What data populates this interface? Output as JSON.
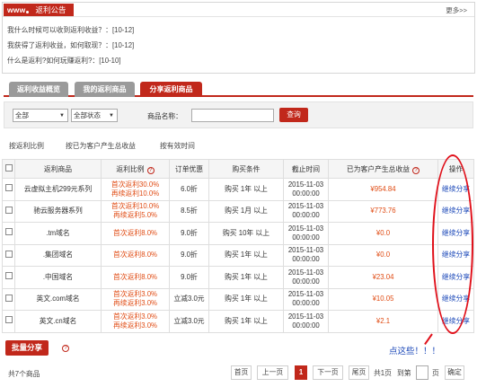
{
  "notice": {
    "logo_www": "www",
    "title": "返利公告",
    "more": "更多>>",
    "items": [
      "我什么时候可以收到返利收益？：[10-12]",
      "我获得了返利收益，如何取现？：[10-12]",
      "什么是返利?如何玩赚返利?：[10-10]"
    ]
  },
  "tabs": [
    "返利收益概览",
    "我的返利商品",
    "分享返利商品"
  ],
  "filter": {
    "select_all": "全部",
    "select_status": "全部状态",
    "name_label": "商品名称：",
    "search_button": "查询"
  },
  "sort": [
    "按返利比例",
    "按已为客户产生总收益",
    "按有效时间"
  ],
  "table": {
    "headers": [
      "返利商品",
      "返利比例",
      "订单优惠",
      "购买条件",
      "截止时间",
      "已为客户产生总收益",
      "操作"
    ],
    "rows": [
      {
        "product": "云虚拟主机299元系列",
        "rate1": "首次返利30.0%",
        "rate2": "再续返利10.0%",
        "discount": "6.0折",
        "condition": "购买 1年 以上",
        "deadline1": "2015-11-03",
        "deadline2": "00:00:00",
        "income": "¥954.84",
        "action": "继续分享"
      },
      {
        "product": "驰云服务器系列",
        "rate1": "首次返利10.0%",
        "rate2": "再续返利5.0%",
        "discount": "8.5折",
        "condition": "购买 1月 以上",
        "deadline1": "2015-11-03",
        "deadline2": "00:00:00",
        "income": "¥773.76",
        "action": "继续分享"
      },
      {
        "product": ".tm域名",
        "rate1": "首次返利8.0%",
        "rate2": "",
        "discount": "9.0折",
        "condition": "购买 10年 以上",
        "deadline1": "2015-11-03",
        "deadline2": "00:00:00",
        "income": "¥0.0",
        "action": "继续分享"
      },
      {
        "product": ".集团域名",
        "rate1": "首次返利8.0%",
        "rate2": "",
        "discount": "9.0折",
        "condition": "购买 1年 以上",
        "deadline1": "2015-11-03",
        "deadline2": "00:00:00",
        "income": "¥0.0",
        "action": "继续分享"
      },
      {
        "product": ".中国域名",
        "rate1": "首次返利8.0%",
        "rate2": "",
        "discount": "9.0折",
        "condition": "购买 1年 以上",
        "deadline1": "2015-11-03",
        "deadline2": "00:00:00",
        "income": "¥23.04",
        "action": "继续分享"
      },
      {
        "product": "英文.com域名",
        "rate1": "首次返利3.0%",
        "rate2": "再续返利3.0%",
        "discount": "立减3.0元",
        "condition": "购买 1年 以上",
        "deadline1": "2015-11-03",
        "deadline2": "00:00:00",
        "income": "¥10.05",
        "action": "继续分享"
      },
      {
        "product": "英文.cn域名",
        "rate1": "首次返利3.0%",
        "rate2": "再续返利3.0%",
        "discount": "立减3.0元",
        "condition": "购买 1年 以上",
        "deadline1": "2015-11-03",
        "deadline2": "00:00:00",
        "income": "¥2.1",
        "action": "继续分享"
      }
    ]
  },
  "annotation": {
    "hint": "点这些！！！"
  },
  "footer": {
    "batch_share": "批量分享",
    "total": "共7个商品",
    "first": "首页",
    "prev": "上一页",
    "current": "1",
    "next": "下一页",
    "last": "尾页",
    "total_pages": "共1页",
    "goto_label": "到第",
    "page_unit": "页",
    "confirm": "确定"
  },
  "colors": {
    "brand": "#c1281b",
    "link": "#1a47b8",
    "highlight": "#e04b13",
    "annotation": "#e0101a"
  }
}
